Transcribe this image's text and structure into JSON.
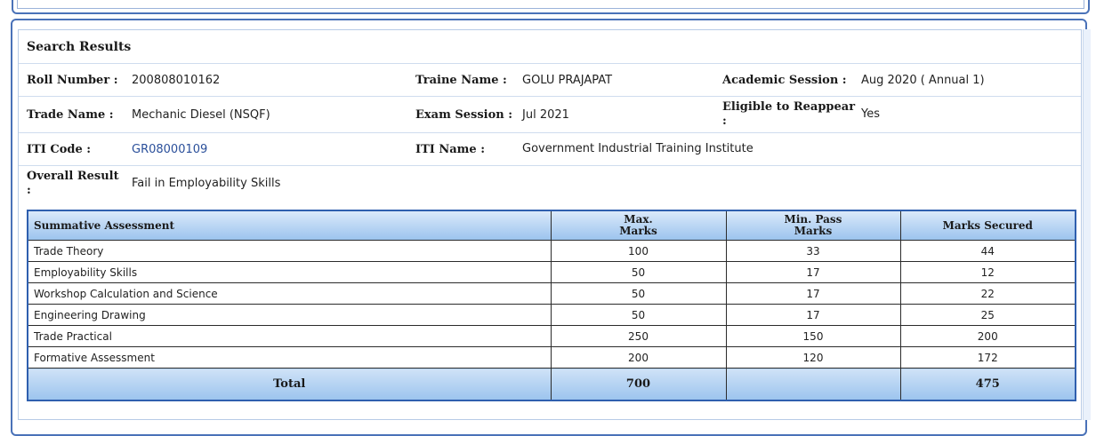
{
  "search_results": {
    "title": "Search Results",
    "fields": {
      "roll_number": {
        "label": "Roll Number :",
        "value": "200808010162"
      },
      "trainee_name": {
        "label": "Traine Name :",
        "value": "GOLU PRAJAPAT"
      },
      "academic_session": {
        "label": "Academic Session :",
        "value": "Aug 2020 ( Annual 1)"
      },
      "trade_name": {
        "label": "Trade Name :",
        "value": "Mechanic Diesel (NSQF)"
      },
      "exam_session": {
        "label": "Exam Session :",
        "value": "Jul 2021"
      },
      "eligible_to_reappear": {
        "label_line1": "Eligible to Reappear",
        "label_line2": ":",
        "value": "Yes"
      },
      "iti_code": {
        "label": "ITI Code :",
        "value": "GR08000109"
      },
      "iti_name": {
        "label": "ITI Name :",
        "value": "Government Industrial Training Institute"
      },
      "overall_result": {
        "label_line1": "Overall Result",
        "label_line2": ":",
        "value": "Fail in Employability Skills"
      }
    }
  },
  "marks_table": {
    "headers": {
      "col1": "Summative Assessment",
      "col2_line1": "Max.",
      "col2_line2": "Marks",
      "col3_line1": "Min. Pass",
      "col3_line2": "Marks",
      "col4": "Marks Secured"
    },
    "rows": [
      {
        "subject": "Trade Theory",
        "max": "100",
        "min": "33",
        "secured": "44"
      },
      {
        "subject": "Employability Skills",
        "max": "50",
        "min": "17",
        "secured": "12"
      },
      {
        "subject": "Workshop Calculation and Science",
        "max": "50",
        "min": "17",
        "secured": "22"
      },
      {
        "subject": "Engineering Drawing",
        "max": "50",
        "min": "17",
        "secured": "25"
      },
      {
        "subject": "Trade Practical",
        "max": "250",
        "min": "150",
        "secured": "200"
      },
      {
        "subject": "Formative Assessment",
        "max": "200",
        "min": "120",
        "secured": "172"
      }
    ],
    "total": {
      "label": "Total",
      "max": "700",
      "min": "",
      "secured": "475"
    }
  },
  "colors": {
    "panel_border": "#4a72b8",
    "header_gradient_top": "#dbe9fa",
    "header_gradient_bottom": "#9cc4ee",
    "link_text": "#2a4f9a"
  }
}
